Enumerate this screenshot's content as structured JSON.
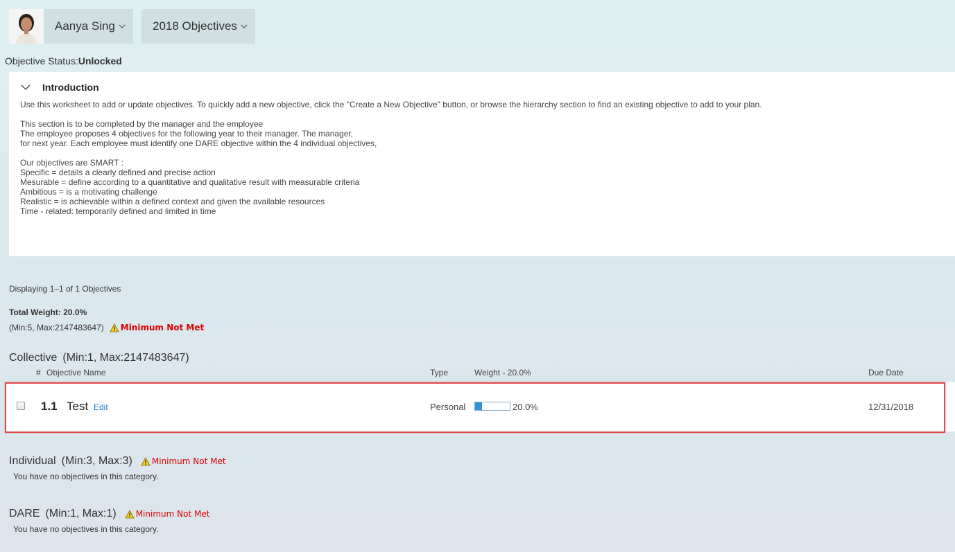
{
  "header": {
    "user_name": "Aanya Sing",
    "plan_name": "2018 Objectives",
    "status_label": "Objective Status:",
    "status_value": "Unlocked"
  },
  "introduction": {
    "title": "Introduction",
    "lines": [
      "Use this worksheet to add or update objectives. To quickly add a new objective, click the \"Create a New Objective\" button, or browse the hierarchy section to find an existing objective to add to your plan.",
      "",
      "This section is to be completed by the manager and the employee",
      "The employee proposes 4 objectives for the following year to their manager. The manager,",
      "for next year. Each employee must identify one DARE objective within the 4 individual objectives,",
      "",
      "Our objectives are SMART :",
      "Specific = details a clearly defined and precise action",
      "Mesurable = define according to a quantitative and qualitative result with measurable criteria",
      "Ambitious = is a motivating challenge",
      "Realistic = is achievable within a defined context and given the available resources",
      "Time - related: temporarily defined and limited in time"
    ]
  },
  "summary": {
    "displaying": "Displaying 1–1 of 1 Objectives",
    "total_weight": "Total Weight: 20.0%",
    "minmax": "(Min:5, Max:2147483647)",
    "warning": "Minimum Not Met"
  },
  "columns": {
    "number": "#",
    "name": "Objective Name",
    "type": "Type",
    "weight": "Weight - 20.0%",
    "due": "Due Date"
  },
  "categories": {
    "collective": {
      "name": "Collective",
      "range": "(Min:1, Max:2147483647)",
      "objectives": [
        {
          "number": "1.1",
          "name": "Test",
          "edit_label": "Edit",
          "type": "Personal",
          "weight_label": "20.0%",
          "weight_fraction": 0.2,
          "due": "12/31/2018"
        }
      ]
    },
    "individual": {
      "name": "Individual",
      "range": "(Min:3, Max:3)",
      "warning": "Minimum Not Met",
      "empty": "You have no objectives in this category."
    },
    "dare": {
      "name": "DARE",
      "range": "(Min:1, Max:1)",
      "warning": "Minimum Not Met",
      "empty": "You have no objectives in this category."
    }
  },
  "colors": {
    "accent_link": "#1a7bc0",
    "warning_text": "#e00000",
    "highlight_border": "#e04848",
    "progress_fill": "#2e96d8"
  },
  "icons": {
    "avatar": "user-photo",
    "dropdown": "chevron-down-icon",
    "warning": "warning-triangle-icon"
  }
}
